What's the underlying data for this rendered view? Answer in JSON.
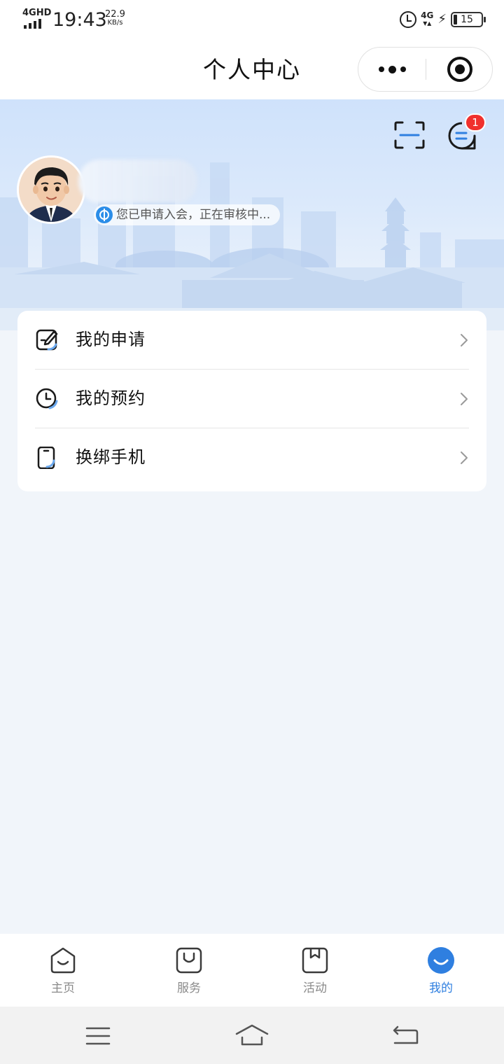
{
  "status_bar": {
    "network": "4GHD",
    "time": "19:43",
    "speed_value": "22.9",
    "speed_unit": "KB/s",
    "network_right": "4G",
    "battery": "15"
  },
  "title_bar": {
    "title": "个人中心",
    "more_icon": "more-dots-icon",
    "close_icon": "target-circle-icon"
  },
  "header": {
    "scan_icon": "scan-icon",
    "message_icon": "message-icon",
    "message_badge": "1",
    "status_text": "您已申请入会，正在审核中...",
    "status_icon": "union-badge-icon"
  },
  "menu": {
    "items": [
      {
        "label": "我的申请",
        "icon": "edit-form-icon"
      },
      {
        "label": "我的预约",
        "icon": "clock-icon"
      },
      {
        "label": "换绑手机",
        "icon": "phone-icon"
      }
    ]
  },
  "tabbar": {
    "active_color": "#2f7fe0",
    "items": [
      {
        "label": "主页",
        "icon": "home-icon",
        "active": false
      },
      {
        "label": "服务",
        "icon": "bag-icon",
        "active": false
      },
      {
        "label": "活动",
        "icon": "bookmark-icon",
        "active": false
      },
      {
        "label": "我的",
        "icon": "smile-icon",
        "active": true
      }
    ]
  },
  "system_nav": {
    "menu_icon": "menu-lines-icon",
    "home_icon": "home-outline-icon",
    "back_icon": "back-arrow-icon"
  }
}
